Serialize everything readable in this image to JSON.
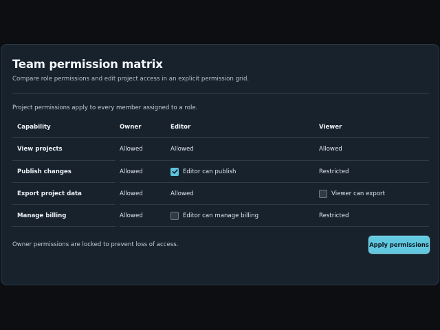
{
  "panel": {
    "title": "Team permission matrix",
    "subtitle": "Compare role permissions and edit project access in an explicit permission grid.",
    "note": "Project permissions apply to every member assigned to a role.",
    "footer_note": "Owner permissions are locked to prevent loss of access.",
    "apply_label": "Apply permissions"
  },
  "table": {
    "headers": [
      "Capability",
      "Owner",
      "Editor",
      "Viewer"
    ],
    "rows": [
      {
        "capability": "View projects",
        "owner": {
          "type": "text",
          "text": "Allowed"
        },
        "editor": {
          "type": "text",
          "text": "Allowed"
        },
        "viewer": {
          "type": "text",
          "text": "Allowed"
        }
      },
      {
        "capability": "Publish changes",
        "owner": {
          "type": "text",
          "text": "Allowed"
        },
        "editor": {
          "type": "checkbox",
          "text": "Editor can publish",
          "checked": true
        },
        "viewer": {
          "type": "text",
          "text": "Restricted"
        }
      },
      {
        "capability": "Export project data",
        "owner": {
          "type": "text",
          "text": "Allowed"
        },
        "editor": {
          "type": "text",
          "text": "Allowed"
        },
        "viewer": {
          "type": "checkbox",
          "text": "Viewer can export",
          "checked": false
        }
      },
      {
        "capability": "Manage billing",
        "owner": {
          "type": "text",
          "text": "Allowed"
        },
        "editor": {
          "type": "checkbox",
          "text": "Editor can manage billing",
          "checked": false
        },
        "viewer": {
          "type": "text",
          "text": "Restricted"
        }
      }
    ]
  },
  "colors": {
    "accent": "#62c8e0",
    "panel_bg": "#18222d",
    "page_bg": "#0c0e12"
  }
}
